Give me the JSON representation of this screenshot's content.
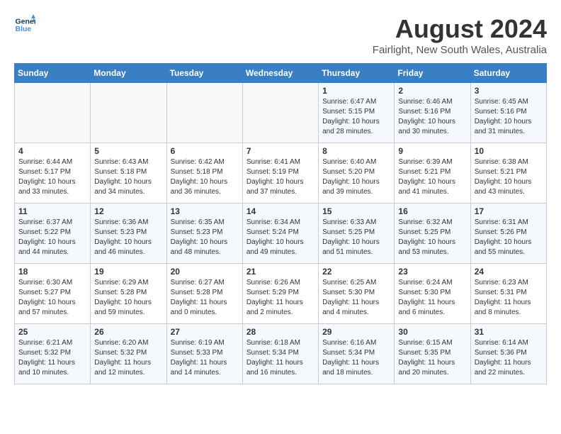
{
  "logo": {
    "line1": "General",
    "line2": "Blue"
  },
  "title": "August 2024",
  "subtitle": "Fairlight, New South Wales, Australia",
  "weekdays": [
    "Sunday",
    "Monday",
    "Tuesday",
    "Wednesday",
    "Thursday",
    "Friday",
    "Saturday"
  ],
  "weeks": [
    [
      {
        "day": "",
        "info": ""
      },
      {
        "day": "",
        "info": ""
      },
      {
        "day": "",
        "info": ""
      },
      {
        "day": "",
        "info": ""
      },
      {
        "day": "1",
        "info": "Sunrise: 6:47 AM\nSunset: 5:15 PM\nDaylight: 10 hours and 28 minutes."
      },
      {
        "day": "2",
        "info": "Sunrise: 6:46 AM\nSunset: 5:16 PM\nDaylight: 10 hours and 30 minutes."
      },
      {
        "day": "3",
        "info": "Sunrise: 6:45 AM\nSunset: 5:16 PM\nDaylight: 10 hours and 31 minutes."
      }
    ],
    [
      {
        "day": "4",
        "info": "Sunrise: 6:44 AM\nSunset: 5:17 PM\nDaylight: 10 hours and 33 minutes."
      },
      {
        "day": "5",
        "info": "Sunrise: 6:43 AM\nSunset: 5:18 PM\nDaylight: 10 hours and 34 minutes."
      },
      {
        "day": "6",
        "info": "Sunrise: 6:42 AM\nSunset: 5:18 PM\nDaylight: 10 hours and 36 minutes."
      },
      {
        "day": "7",
        "info": "Sunrise: 6:41 AM\nSunset: 5:19 PM\nDaylight: 10 hours and 37 minutes."
      },
      {
        "day": "8",
        "info": "Sunrise: 6:40 AM\nSunset: 5:20 PM\nDaylight: 10 hours and 39 minutes."
      },
      {
        "day": "9",
        "info": "Sunrise: 6:39 AM\nSunset: 5:21 PM\nDaylight: 10 hours and 41 minutes."
      },
      {
        "day": "10",
        "info": "Sunrise: 6:38 AM\nSunset: 5:21 PM\nDaylight: 10 hours and 43 minutes."
      }
    ],
    [
      {
        "day": "11",
        "info": "Sunrise: 6:37 AM\nSunset: 5:22 PM\nDaylight: 10 hours and 44 minutes."
      },
      {
        "day": "12",
        "info": "Sunrise: 6:36 AM\nSunset: 5:23 PM\nDaylight: 10 hours and 46 minutes."
      },
      {
        "day": "13",
        "info": "Sunrise: 6:35 AM\nSunset: 5:23 PM\nDaylight: 10 hours and 48 minutes."
      },
      {
        "day": "14",
        "info": "Sunrise: 6:34 AM\nSunset: 5:24 PM\nDaylight: 10 hours and 49 minutes."
      },
      {
        "day": "15",
        "info": "Sunrise: 6:33 AM\nSunset: 5:25 PM\nDaylight: 10 hours and 51 minutes."
      },
      {
        "day": "16",
        "info": "Sunrise: 6:32 AM\nSunset: 5:25 PM\nDaylight: 10 hours and 53 minutes."
      },
      {
        "day": "17",
        "info": "Sunrise: 6:31 AM\nSunset: 5:26 PM\nDaylight: 10 hours and 55 minutes."
      }
    ],
    [
      {
        "day": "18",
        "info": "Sunrise: 6:30 AM\nSunset: 5:27 PM\nDaylight: 10 hours and 57 minutes."
      },
      {
        "day": "19",
        "info": "Sunrise: 6:29 AM\nSunset: 5:28 PM\nDaylight: 10 hours and 59 minutes."
      },
      {
        "day": "20",
        "info": "Sunrise: 6:27 AM\nSunset: 5:28 PM\nDaylight: 11 hours and 0 minutes."
      },
      {
        "day": "21",
        "info": "Sunrise: 6:26 AM\nSunset: 5:29 PM\nDaylight: 11 hours and 2 minutes."
      },
      {
        "day": "22",
        "info": "Sunrise: 6:25 AM\nSunset: 5:30 PM\nDaylight: 11 hours and 4 minutes."
      },
      {
        "day": "23",
        "info": "Sunrise: 6:24 AM\nSunset: 5:30 PM\nDaylight: 11 hours and 6 minutes."
      },
      {
        "day": "24",
        "info": "Sunrise: 6:23 AM\nSunset: 5:31 PM\nDaylight: 11 hours and 8 minutes."
      }
    ],
    [
      {
        "day": "25",
        "info": "Sunrise: 6:21 AM\nSunset: 5:32 PM\nDaylight: 11 hours and 10 minutes."
      },
      {
        "day": "26",
        "info": "Sunrise: 6:20 AM\nSunset: 5:32 PM\nDaylight: 11 hours and 12 minutes."
      },
      {
        "day": "27",
        "info": "Sunrise: 6:19 AM\nSunset: 5:33 PM\nDaylight: 11 hours and 14 minutes."
      },
      {
        "day": "28",
        "info": "Sunrise: 6:18 AM\nSunset: 5:34 PM\nDaylight: 11 hours and 16 minutes."
      },
      {
        "day": "29",
        "info": "Sunrise: 6:16 AM\nSunset: 5:34 PM\nDaylight: 11 hours and 18 minutes."
      },
      {
        "day": "30",
        "info": "Sunrise: 6:15 AM\nSunset: 5:35 PM\nDaylight: 11 hours and 20 minutes."
      },
      {
        "day": "31",
        "info": "Sunrise: 6:14 AM\nSunset: 5:36 PM\nDaylight: 11 hours and 22 minutes."
      }
    ]
  ]
}
